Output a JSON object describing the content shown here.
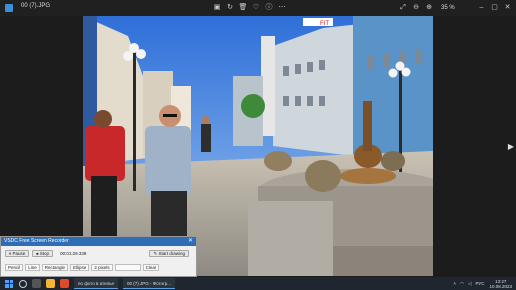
{
  "window": {
    "title": "00 (7).JPG"
  },
  "toolbar": {
    "zoom": "35 %",
    "icons": [
      "image-edit-icon",
      "rotate-icon",
      "delete-icon",
      "favorite-icon",
      "info-icon",
      "more-icon",
      "fullscreen-icon",
      "zoom-out-icon",
      "zoom-in-icon"
    ]
  },
  "window_controls": {
    "minimize": "–",
    "maximize": "▢",
    "close": "✕"
  },
  "nav": {
    "next": "▶"
  },
  "photo": {
    "sign_text": "FIT"
  },
  "recorder": {
    "title": "VSDC Free Screen Recorder",
    "pause": "Pause",
    "stop": "Stop",
    "time": "00:01:29.339",
    "start_drawing": "Start drawing",
    "tools": [
      "Pencil",
      "Line",
      "Rectangle",
      "Ellipse",
      "2 pixels",
      "Clear"
    ]
  },
  "taskbar": {
    "items": [
      "по фото в ателье",
      "00 (7).JPG - Фотогр..."
    ],
    "lang": "РУС",
    "time": "13:27",
    "date": "10.08.2023"
  },
  "colors": {
    "accent": "#2f6db5",
    "taskbar": "#1f2630",
    "titlebar": "#202020"
  }
}
